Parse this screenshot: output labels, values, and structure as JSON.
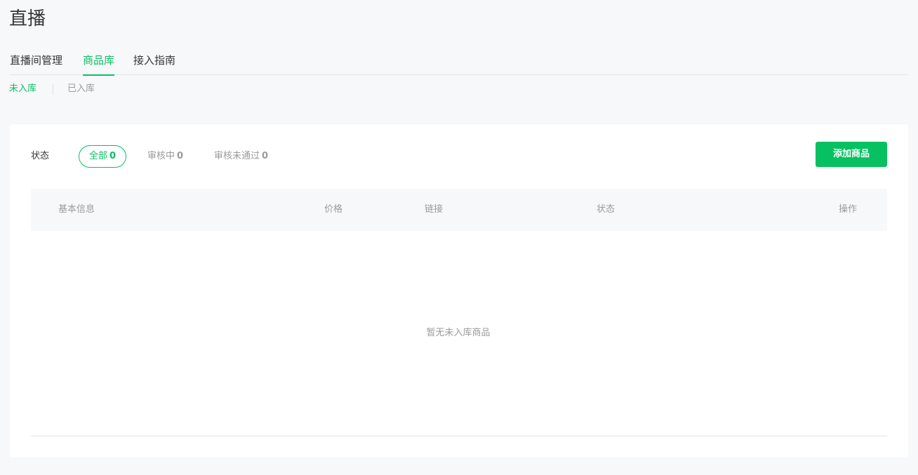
{
  "page": {
    "title": "直播"
  },
  "main_tabs": [
    {
      "label": "直播间管理",
      "active": false
    },
    {
      "label": "商品库",
      "active": true
    },
    {
      "label": "接入指南",
      "active": false
    }
  ],
  "sub_tabs": [
    {
      "label": "未入库",
      "active": true
    },
    {
      "label": "已入库",
      "active": false
    }
  ],
  "filters": {
    "label": "状态",
    "items": [
      {
        "label": "全部",
        "count": "0",
        "active": true
      },
      {
        "label": "审核中",
        "count": "0",
        "active": false
      },
      {
        "label": "审核未通过",
        "count": "0",
        "active": false
      }
    ]
  },
  "toolbar": {
    "add_label": "添加商品"
  },
  "table": {
    "columns": [
      "基本信息",
      "价格",
      "链接",
      "状态",
      "操作"
    ],
    "rows": [],
    "empty_text": "暂无未入库商品"
  },
  "colors": {
    "accent": "#07c160",
    "muted": "#9a9a9a",
    "text": "#353535"
  }
}
